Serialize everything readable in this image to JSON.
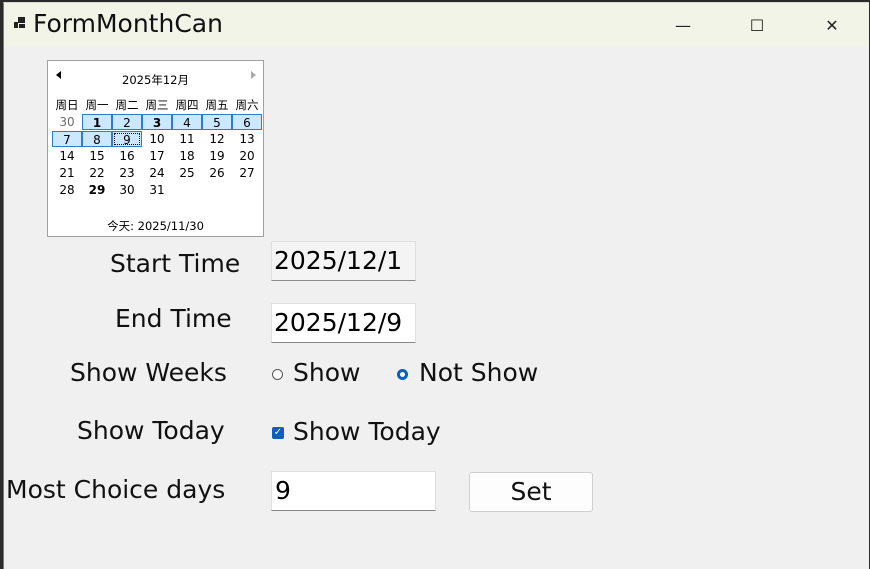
{
  "window": {
    "title": "FormMonthCan",
    "minimize_glyph": "—",
    "maximize_glyph": "☐",
    "close_glyph": "✕"
  },
  "calendar": {
    "month_label": "2025年12月",
    "weekdays": [
      "周日",
      "周一",
      "周二",
      "周三",
      "周四",
      "周五",
      "周六"
    ],
    "weeks": [
      [
        "30",
        "1",
        "2",
        "3",
        "4",
        "5",
        "6"
      ],
      [
        "7",
        "8",
        "9",
        "10",
        "11",
        "12",
        "13"
      ],
      [
        "14",
        "15",
        "16",
        "17",
        "18",
        "19",
        "20"
      ],
      [
        "21",
        "22",
        "23",
        "24",
        "25",
        "26",
        "27"
      ],
      [
        "28",
        "29",
        "30",
        "31",
        "",
        "",
        ""
      ]
    ],
    "today_label": "今天: 2025/11/30"
  },
  "form": {
    "start_time_label": "Start Time",
    "start_time_value": "2025/12/1",
    "end_time_label": "End Time",
    "end_time_value": "2025/12/9",
    "show_weeks_label": "Show Weeks",
    "show_option": "Show",
    "not_show_option": "Not Show",
    "show_weeks_selected": "Not Show",
    "show_today_label": "Show Today",
    "show_today_checkbox": "Show Today",
    "show_today_checked": true,
    "most_choice_label": "Most Choice days",
    "most_choice_value": "9",
    "set_button": "Set"
  },
  "colors": {
    "accent": "#0a5fbf",
    "selection": "#cce8ff",
    "window_bg": "#f0f0f0"
  }
}
